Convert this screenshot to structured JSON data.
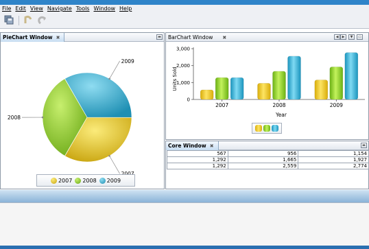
{
  "menu": [
    {
      "id": "file",
      "label": "File"
    },
    {
      "id": "edit",
      "label": "Edit"
    },
    {
      "id": "view",
      "label": "View"
    },
    {
      "id": "navigate",
      "label": "Navigate"
    },
    {
      "id": "tools",
      "label": "Tools"
    },
    {
      "id": "window",
      "label": "Window"
    },
    {
      "id": "help",
      "label": "Help"
    }
  ],
  "toolbar": {
    "icons": [
      "save-all-icon",
      "undo-icon",
      "redo-icon"
    ]
  },
  "pie_window": {
    "tab_label": "PieChart Window",
    "close_glyph": "✖",
    "legend": [
      {
        "label": "2007",
        "color": "#e7c21c"
      },
      {
        "label": "2008",
        "color": "#8cc823"
      },
      {
        "label": "2009",
        "color": "#2ba9cc"
      }
    ]
  },
  "bar_window": {
    "tab_label": "BarChart Window",
    "close_glyph": "✖"
  },
  "core_window": {
    "tab_label": "Core Window",
    "close_glyph": "✖",
    "rows": [
      [
        "567",
        "956",
        "1,154"
      ],
      [
        "1,292",
        "1,665",
        "1,927"
      ],
      [
        "1,292",
        "2,559",
        "2,774"
      ]
    ]
  },
  "chart_data": [
    {
      "type": "pie",
      "labels": [
        "2007",
        "2008",
        "2009"
      ],
      "values": [
        33.3,
        33.3,
        33.4
      ],
      "colors": [
        "#e7c21c",
        "#8cc823",
        "#2ba9cc"
      ],
      "legend_placement": "bottom"
    },
    {
      "type": "bar",
      "categories": [
        "2007",
        "2008",
        "2009"
      ],
      "series": [
        {
          "values": [
            567,
            956,
            1154
          ],
          "color": "#f0c81a"
        },
        {
          "values": [
            1292,
            1665,
            1927
          ],
          "color": "#8fd12a"
        },
        {
          "values": [
            1292,
            2559,
            2774
          ],
          "color": "#2ab0d4"
        }
      ],
      "xlabel": "Year",
      "ylabel": "Units Sold",
      "ylim": [
        0,
        3000
      ],
      "yticks": [
        "0",
        "1,000",
        "2,000",
        "3,000"
      ],
      "grid": false,
      "legend_placement": "bottom"
    }
  ]
}
